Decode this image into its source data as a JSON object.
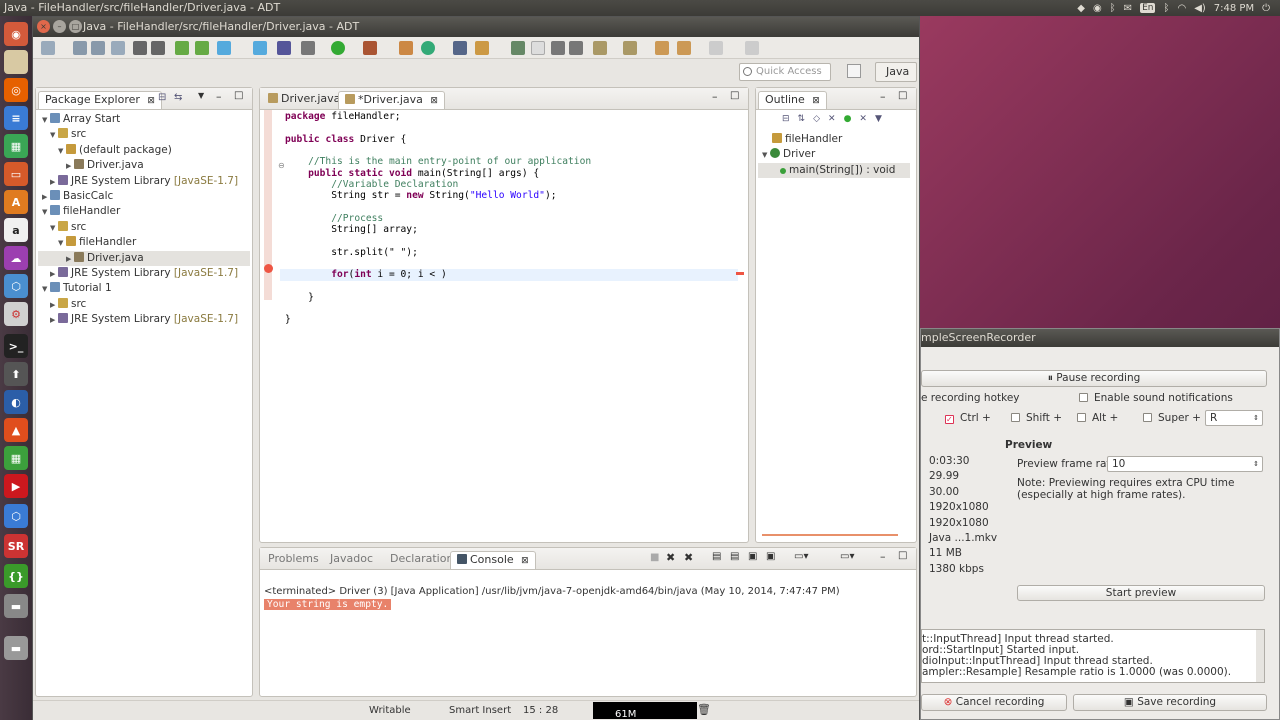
{
  "top_panel": {
    "title": "Java - FileHandler/src/fileHandler/Driver.java - ADT",
    "keyboard": "En",
    "clock": "7:48 PM"
  },
  "window": {
    "title": "Java - FileHandler/src/fileHandler/Driver.java - ADT",
    "quick_access_placeholder": "Quick Access",
    "perspective": "Java"
  },
  "package_explorer": {
    "tab": "Package Explorer",
    "rows": [
      {
        "text": "Array Start",
        "deco": "",
        "level": 0,
        "twisty": "▼",
        "icon": "project"
      },
      {
        "text": "src",
        "deco": "",
        "level": 1,
        "twisty": "▼",
        "icon": "srcfolder"
      },
      {
        "text": "(default package)",
        "deco": "",
        "level": 2,
        "twisty": "▼",
        "icon": "package"
      },
      {
        "text": "Driver.java",
        "deco": "",
        "level": 3,
        "twisty": "▶",
        "icon": "java"
      },
      {
        "text": "JRE System Library",
        "deco": " [JavaSE-1.7]",
        "level": 1,
        "twisty": "▶",
        "icon": "lib"
      },
      {
        "text": "BasicCalc",
        "deco": "",
        "level": 0,
        "twisty": "▶",
        "icon": "project"
      },
      {
        "text": "fileHandler",
        "deco": "",
        "level": 0,
        "twisty": "▼",
        "icon": "project"
      },
      {
        "text": "src",
        "deco": "",
        "level": 1,
        "twisty": "▼",
        "icon": "srcfolder"
      },
      {
        "text": "fileHandler",
        "deco": "",
        "level": 2,
        "twisty": "▼",
        "icon": "package"
      },
      {
        "text": "Driver.java",
        "deco": "",
        "level": 3,
        "twisty": "▶",
        "icon": "java",
        "selected": true
      },
      {
        "text": "JRE System Library",
        "deco": " [JavaSE-1.7]",
        "level": 1,
        "twisty": "▶",
        "icon": "lib"
      },
      {
        "text": "Tutorial 1",
        "deco": "",
        "level": 0,
        "twisty": "▼",
        "icon": "project"
      },
      {
        "text": "src",
        "deco": "",
        "level": 1,
        "twisty": "▶",
        "icon": "srcfolder"
      },
      {
        "text": "JRE System Library",
        "deco": " [JavaSE-1.7]",
        "level": 1,
        "twisty": "▶",
        "icon": "lib"
      }
    ]
  },
  "editor": {
    "tabs": [
      "Driver.java",
      "*Driver.java"
    ],
    "lines": [
      [
        [
          "kw",
          "package"
        ],
        [
          "p",
          " fileHandler;"
        ]
      ],
      [],
      [
        [
          "kw",
          "public"
        ],
        [
          "p",
          " "
        ],
        [
          "kw",
          "class"
        ],
        [
          "p",
          " Driver {"
        ]
      ],
      [],
      [
        [
          "p",
          "    "
        ],
        [
          "cm",
          "//This is the main entry-point of our application"
        ]
      ],
      [
        [
          "p",
          "    "
        ],
        [
          "kw",
          "public"
        ],
        [
          "p",
          " "
        ],
        [
          "kw",
          "static"
        ],
        [
          "p",
          " "
        ],
        [
          "kw",
          "void"
        ],
        [
          "p",
          " main(String[] args) {"
        ]
      ],
      [
        [
          "p",
          "        "
        ],
        [
          "cm",
          "//Variable Declaration"
        ]
      ],
      [
        [
          "p",
          "        String str = "
        ],
        [
          "kw",
          "new"
        ],
        [
          "p",
          " String("
        ],
        [
          "st",
          "\"Hello World\""
        ],
        [
          "p",
          ");"
        ]
      ],
      [],
      [
        [
          "p",
          "        "
        ],
        [
          "cm",
          "//Process"
        ]
      ],
      [
        [
          "p",
          "        String[] array;"
        ]
      ],
      [],
      [
        [
          "p",
          "        str.split(\" \");"
        ]
      ],
      [],
      [
        [
          "p",
          "        "
        ],
        [
          "kw",
          "for"
        ],
        [
          "p",
          "("
        ],
        [
          "kw",
          "int"
        ],
        [
          "p",
          " i = 0; i < )"
        ]
      ],
      [],
      [
        [
          "p",
          "    }"
        ]
      ],
      [],
      [
        [
          "p",
          "}"
        ]
      ]
    ]
  },
  "outline": {
    "tab": "Outline",
    "rows": [
      {
        "text": "fileHandler",
        "level": 0,
        "icon": "package"
      },
      {
        "text": "Driver",
        "level": 0,
        "icon": "class",
        "twisty": "▼"
      },
      {
        "text": "main(String[]) : void",
        "level": 1,
        "icon": "method",
        "selected": true
      }
    ]
  },
  "console": {
    "tabs": [
      "Problems",
      "Javadoc",
      "Declaration",
      "Console"
    ],
    "terminated_line": "<terminated> Driver (3) [Java Application] /usr/lib/jvm/java-7-openjdk-amd64/bin/java (May 10, 2014, 7:47:47 PM)",
    "output_line": "Your string is empty."
  },
  "status": {
    "writable": "Writable",
    "insert_mode": "Smart Insert",
    "position": "15 : 28",
    "heap": "61M"
  },
  "recorder": {
    "title": "mpleScreenRecorder",
    "pause_label": "Pause recording",
    "hotkey_label": "e recording hotkey",
    "sound_label": "Enable sound notifications",
    "mods": [
      "Ctrl +",
      "Shift +",
      "Alt +",
      "Super +"
    ],
    "key_value": "R",
    "stats": [
      "0:03:30",
      "29.99",
      "30.00",
      "1920x1080",
      "1920x1080",
      "Java ...1.mkv",
      "11 MB",
      "1380 kbps"
    ],
    "preview_heading": "Preview",
    "frame_rate_label": "Preview frame rate:",
    "frame_rate_value": "10",
    "note": "Note: Previewing requires extra CPU time (especially at high frame rates).",
    "start_preview_label": "Start preview",
    "log_lines": [
      "t::InputThread] Input thread started.",
      "ord::StartInput] Started input.",
      "dioInput::InputThread] Input thread started.",
      "ampler::Resample] Resample ratio is 1.0000 (was 0.0000)."
    ],
    "cancel_label": "Cancel recording",
    "save_label": "Save recording"
  }
}
